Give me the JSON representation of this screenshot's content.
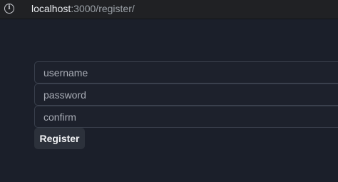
{
  "browser": {
    "url_host": "localhost",
    "url_path": ":3000/register/",
    "info_icon": "info-icon"
  },
  "form": {
    "username_placeholder": "username",
    "username_value": "",
    "password_placeholder": "password",
    "password_value": "",
    "confirm_placeholder": "confirm",
    "confirm_value": "",
    "submit_label": "Register"
  },
  "colors": {
    "background": "#1b1f2a",
    "field_border": "#3a404d",
    "button_bg": "#2c313b"
  }
}
